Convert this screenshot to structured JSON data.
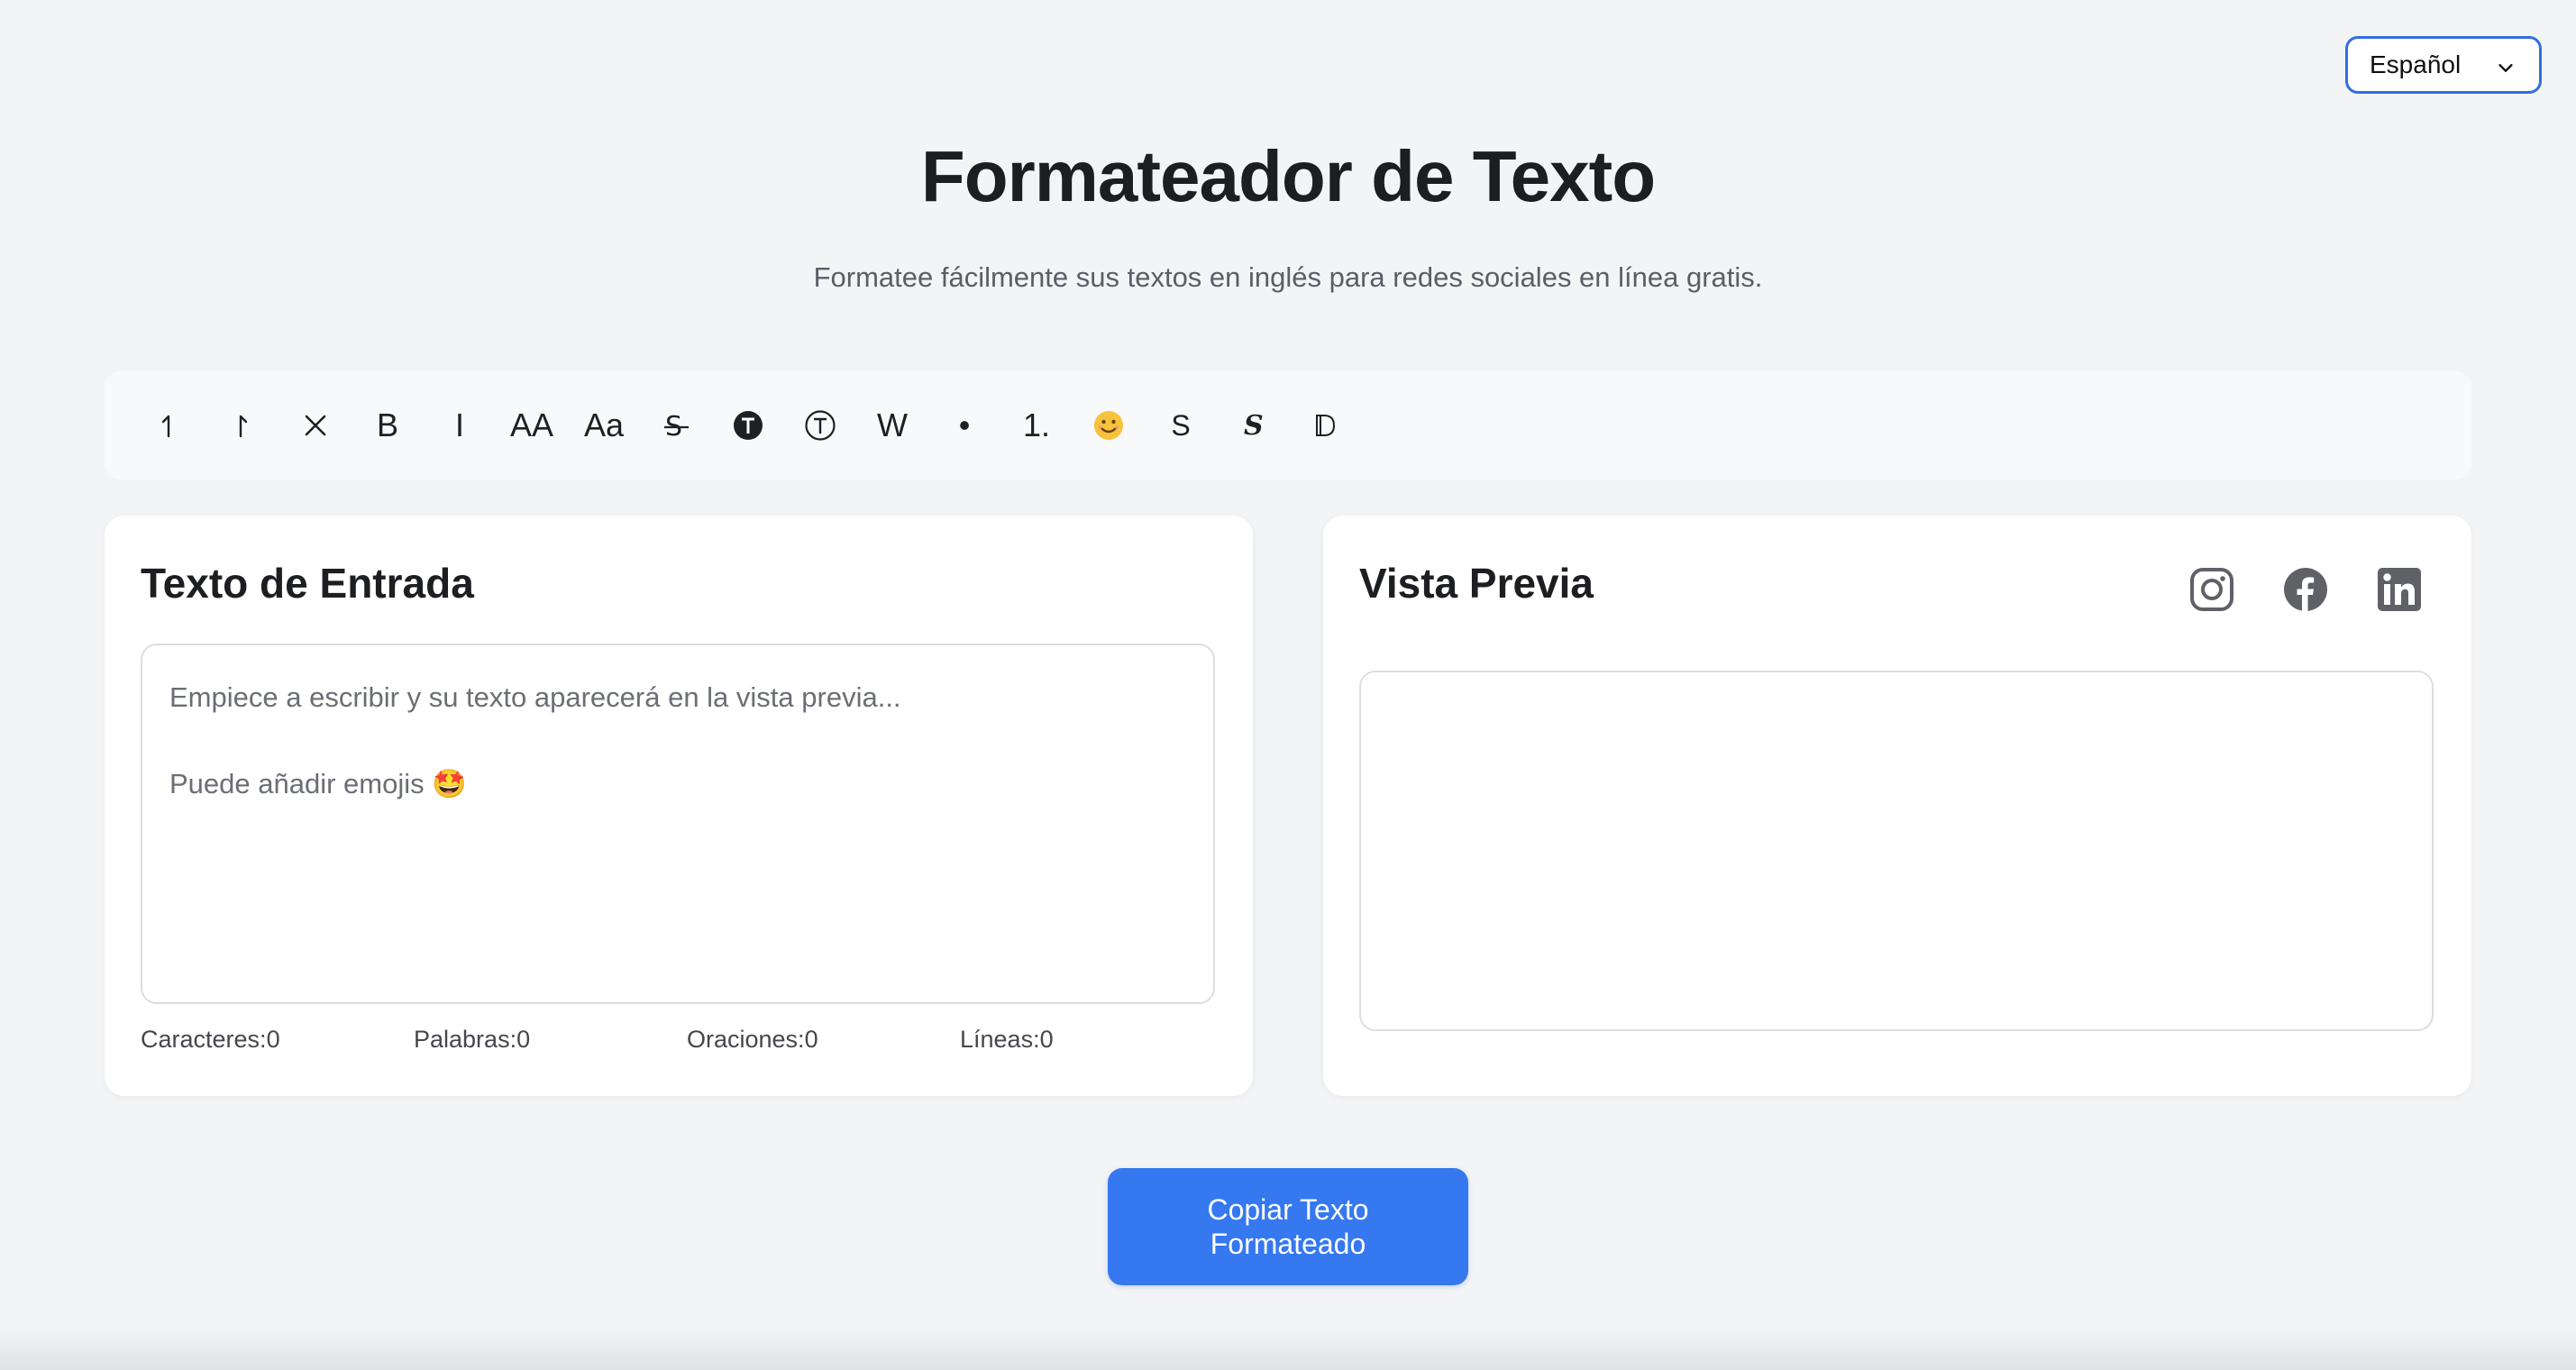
{
  "language_select": {
    "selected": "Español"
  },
  "header": {
    "title": "Formateador de Texto",
    "subtitle": "Formatee fácilmente sus textos en inglés para redes sociales en línea gratis."
  },
  "toolbar": {
    "tools": [
      {
        "name": "undo",
        "glyph": "↰"
      },
      {
        "name": "redo",
        "glyph": "↱"
      },
      {
        "name": "clear",
        "glyph": "✕"
      },
      {
        "name": "bold",
        "glyph": "B"
      },
      {
        "name": "italic",
        "glyph": "I"
      },
      {
        "name": "uppercase",
        "glyph": "AA"
      },
      {
        "name": "capitalize",
        "glyph": "Aa"
      },
      {
        "name": "strikethrough",
        "glyph": "S̶"
      },
      {
        "name": "circled-filled",
        "glyph": "🅣"
      },
      {
        "name": "circled",
        "glyph": "Ⓣ"
      },
      {
        "name": "wide",
        "glyph": "W"
      },
      {
        "name": "bullet-list",
        "glyph": "•"
      },
      {
        "name": "numbered-list",
        "glyph": "1."
      },
      {
        "name": "emoji",
        "glyph": "😊"
      },
      {
        "name": "sans",
        "glyph": "S"
      },
      {
        "name": "script",
        "glyph": "𝓈"
      },
      {
        "name": "double-struck",
        "glyph": "𝔻"
      }
    ]
  },
  "input_panel": {
    "title": "Texto de Entrada",
    "placeholder": "Empiece a escribir y su texto aparecerá en la vista previa...\n\nPuede añadir emojis 🤩",
    "stats": [
      {
        "label": "Caracteres:",
        "value": "0"
      },
      {
        "label": "Palabras:",
        "value": "0"
      },
      {
        "label": "Oraciones:",
        "value": "0"
      },
      {
        "label": "Líneas:",
        "value": "0"
      }
    ]
  },
  "preview_panel": {
    "title": "Vista Previa",
    "socials": [
      "instagram-icon",
      "facebook-icon",
      "linkedin-icon"
    ]
  },
  "copy_button": {
    "label": "Copiar Texto Formateado"
  },
  "colors": {
    "accent": "#3578f0",
    "select_border": "#2f6fe0",
    "background": "#f3f4f6",
    "social_icon": "#5f6167"
  }
}
